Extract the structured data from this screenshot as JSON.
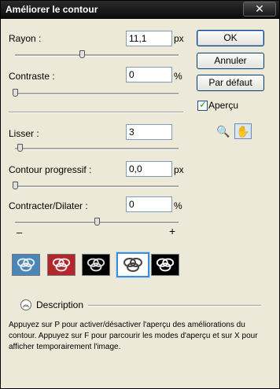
{
  "window": {
    "title": "Améliorer le contour",
    "close_glyph": "✕"
  },
  "rayon": {
    "label": "Rayon :",
    "value": "11,1",
    "unit": "px",
    "slider_fraction": 0.41
  },
  "contraste": {
    "label": "Contraste :",
    "value": "0",
    "unit": "%",
    "slider_fraction": 0.0
  },
  "lisser": {
    "label": "Lisser :",
    "value": "3",
    "slider_fraction": 0.03
  },
  "contour_progressif": {
    "label": "Contour progressif :",
    "value": "0,0",
    "unit": "px",
    "slider_fraction": 0.0
  },
  "contracter": {
    "label": "Contracter/Dilater :",
    "value": "0",
    "unit": "%",
    "slider_fraction": 0.5,
    "minus": "–",
    "plus": "+"
  },
  "buttons": {
    "ok": "OK",
    "cancel": "Annuler",
    "default": "Par défaut"
  },
  "preview": {
    "label": "Aperçu",
    "checked": true,
    "check_glyph": "✓"
  },
  "tools": {
    "zoom_glyph": "🔍",
    "hand_glyph": "✋",
    "selected": "hand"
  },
  "preview_modes": [
    {
      "name": "standard",
      "bg": "#4a86b8",
      "stroke": "#eeeeee",
      "selected": false
    },
    {
      "name": "quick-mask",
      "bg": "#b3262c",
      "stroke": "#f2f2f2",
      "selected": false
    },
    {
      "name": "on-black",
      "bg": "#000000",
      "stroke": "#dddddd",
      "selected": false
    },
    {
      "name": "on-white",
      "bg": "#ffffff",
      "stroke": "#444444",
      "selected": true
    },
    {
      "name": "mask",
      "bg": "#000000",
      "stroke": "#ffffff",
      "selected": false
    }
  ],
  "description": {
    "label": "Description",
    "text": "Appuyez sur P pour activer/désactiver l'aperçu des améliorations du contour. Appuyez sur F pour parcourir les modes d'aperçu et sur X pour afficher temporairement l'image."
  }
}
